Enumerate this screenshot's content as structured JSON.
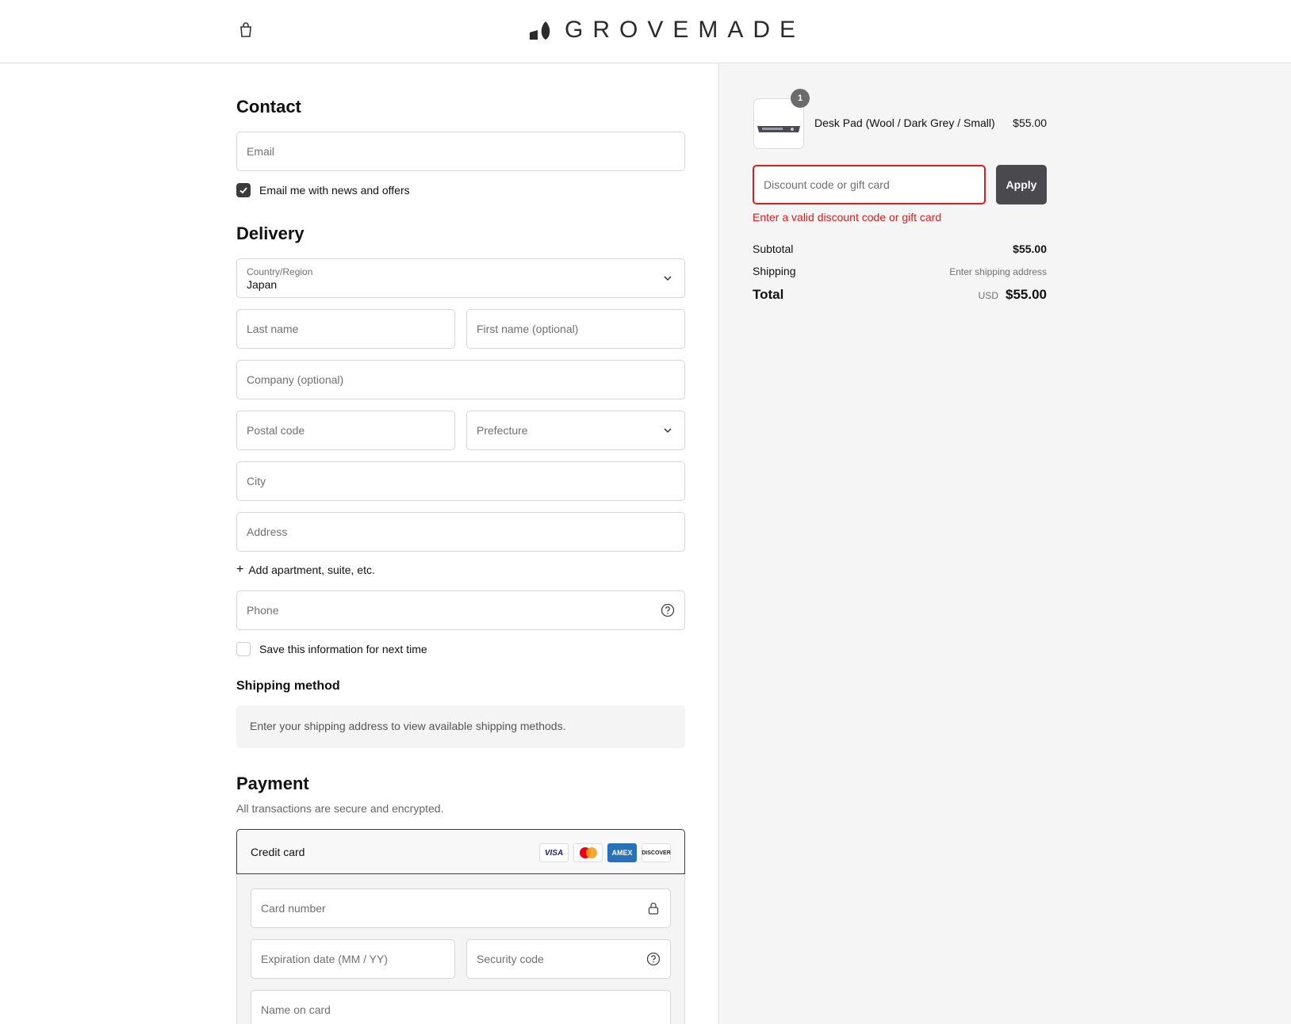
{
  "header": {
    "brand": "GROVEMADE",
    "cart_icon": "shopping-bag-icon"
  },
  "contact": {
    "title": "Contact",
    "email_placeholder": "Email",
    "news_label": "Email me with news and offers",
    "news_checked": true
  },
  "delivery": {
    "title": "Delivery",
    "country_label": "Country/Region",
    "country_value": "Japan",
    "last_name_placeholder": "Last name",
    "first_name_placeholder": "First name (optional)",
    "company_placeholder": "Company (optional)",
    "postal_placeholder": "Postal code",
    "prefecture_placeholder": "Prefecture",
    "city_placeholder": "City",
    "address_placeholder": "Address",
    "add_apartment": "Add apartment, suite, etc.",
    "phone_placeholder": "Phone",
    "save_info_label": "Save this information for next time",
    "save_info_checked": false
  },
  "shipping_method": {
    "title": "Shipping method",
    "notice": "Enter your shipping address to view available shipping methods."
  },
  "payment": {
    "title": "Payment",
    "subtitle": "All transactions are secure and encrypted.",
    "method_label": "Credit card",
    "brands": [
      "VISA",
      "Mastercard",
      "AMEX",
      "DISCOVER"
    ],
    "card_number_placeholder": "Card number",
    "expiration_placeholder": "Expiration date (MM / YY)",
    "security_placeholder": "Security code",
    "name_placeholder": "Name on card"
  },
  "summary": {
    "item": {
      "quantity": "1",
      "name": "Desk Pad (Wool / Dark Grey / Small)",
      "price": "$55.00"
    },
    "discount_placeholder": "Discount code or gift card",
    "apply_label": "Apply",
    "discount_error": "Enter a valid discount code or gift card",
    "subtotal_label": "Subtotal",
    "subtotal_value": "$55.00",
    "shipping_label": "Shipping",
    "shipping_value": "Enter shipping address",
    "total_label": "Total",
    "total_currency": "USD",
    "total_value": "$55.00"
  },
  "colors": {
    "error": "#dd1d1d",
    "button": "#4a4a4e",
    "summary_bg": "#f5f5f5"
  }
}
